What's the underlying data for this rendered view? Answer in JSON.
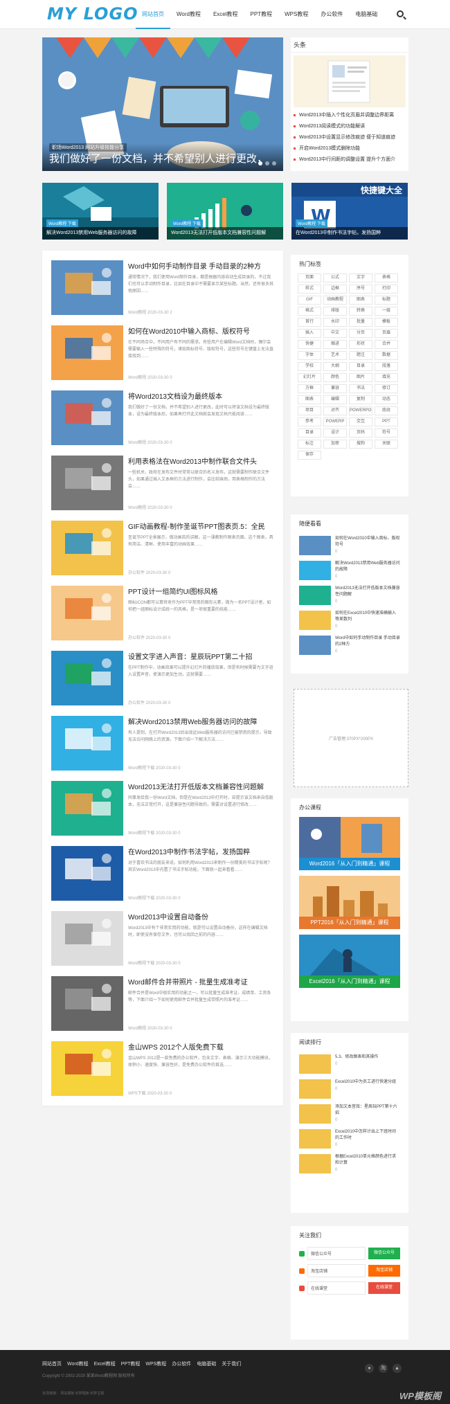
{
  "logo": "MY LOGO",
  "nav": [
    "网站首页",
    "Word教程",
    "Excel教程",
    "PPT教程",
    "WPS教程",
    "办公软件",
    "电脑基础"
  ],
  "slider": {
    "tag": "职场Word2013 网站升级技能分享",
    "title": "我们做好了一份文档，并不希望别人进行更改，"
  },
  "headlines": {
    "title": "头条",
    "items": [
      "Word2013中插入个性化页眉并调整边界距离",
      "Word2013阅读模式的功能解读",
      "Word2013中设置显示修改痕迹 便于知道痕迹",
      "开启Word2013模式删除功能",
      "Word2013中行间距的调整设置 提升个方面介"
    ]
  },
  "features": [
    {
      "tag": "Word教程 下载",
      "label": "解决Word2013禁用Web服务器访问的故障"
    },
    {
      "tag": "Word教程 下载",
      "label": "Word2013无法打开低版本文档兼容性问题解"
    },
    {
      "tag": "Word教程 下载",
      "label": "在Word2013中制作书法字帖，发扬国粹"
    }
  ],
  "articles": [
    {
      "title": "Word中如何手动制作目录 手动目录的2种方",
      "desc": "通常情况下，我们使用Word制作目录，都是根据内容自动生成目录的，不过我们也可以手动制作目录，比如在目录中不需要显示某些标题。当然，还有很多其他原因……",
      "meta": "Word教程 2020-03-30 2"
    },
    {
      "title": "如何在Word2010中输入商标、版权符号",
      "desc": "在不同场合中，不同用户有不同的需求。有些用户在编辑Word文档时，偶尔会需要输入一些特殊的符号，诸如商标符号、版权符号，这些符号在键盘上无法直接找到……",
      "meta": "Word教程 2020-03-30 0"
    },
    {
      "title": "将Word2013文档设为最终版本",
      "desc": "我们做好了一份文档，并不希望别人进行更改，此时可以将该文档设为最终版本，设为最终版本后，如果再打开此文档就会发现文档只能阅读……",
      "meta": "Word教程 2020-03-30 0"
    },
    {
      "title": "利用表格法在Word2013中制作联合文件头",
      "desc": "一些机关、政府在发布文件时常常以联合的名义发布，这就需要制作联合文件头，如果通过插入文本框的方法进行制作，会比较麻烦，用表格制作的方法会……",
      "meta": "Word教程 2020-03-30 0"
    },
    {
      "title": "GIF动画教程-制作圣诞节PPT图表页.5：全民",
      "desc": "圣诞节PPT全景展示，做动画前的讲解，这一课教制作图表页面。这个图表，具有简洁、清晰、使用丰富的动画效果……",
      "meta": "办公软件 2020-03-30 0"
    },
    {
      "title": "PPT设计一组简约UI图标风格",
      "desc": "图标ICON都可以算将来作为PPT中常用的图形元素，做为一名PPT设计者，如何把一组图标设计成统一的风格，是一项很重要的技能……",
      "meta": "办公软件 2020-03-30 0"
    },
    {
      "title": "设置文字进入声音：星辰玩PPT第二十招",
      "desc": "在PPT制作中，动画效果可以提升幻灯片的播放效果，但是有时候需要为文字进入设置声音，使演示更加生动，这就需要……",
      "meta": "办公软件 2020-03-30 0"
    },
    {
      "title": "解决Word2013禁用Web服务器访问的故障",
      "desc": "有人提到，在打开Word2013后出现此Web服务器的访问已被禁用的提示，导致无法访问网络上的资源，下面介绍一下解决方法……",
      "meta": "Word教程下载 2020-03-30 0"
    },
    {
      "title": "Word2013无法打开低版本文档兼容性问题解",
      "desc": "同事发给我一份Word文档，但是在Word2013中打开时，却提示该文档来自低版本，无法正常打开，这是兼容性问题导致的，需要对设置进行修改……",
      "meta": "Word教程下载 2020-03-30 0"
    },
    {
      "title": "在Word2013中制作书法字帖，发扬国粹",
      "desc": "对于喜欢书法的朋友来说，如何利用Word2013来制作一份精美的书法字帖呢？其实Word2013中内置了书法字帖功能，下面就一起来看看……",
      "meta": "Word教程下载 2020-03-30 0"
    },
    {
      "title": "Word2013中设置自动备份",
      "desc": "Word2013中有个非常实用的功能，就是可以设置自动备份，这样在编辑文档时，即使没有保存文件，也可以找回之前的内容……",
      "meta": "Word教程下载 2020-03-30 0"
    },
    {
      "title": "Word邮件合并带照片 - 批量生成准考证",
      "desc": "邮件合并是Word中很实用的功能之一，可以批量生成准考证、成绩单、工资条等，下面介绍一下如何使用邮件合并批量生成带照片的准考证……",
      "meta": "Word教程 2020-03-30 0"
    },
    {
      "title": "金山WPS 2012个人版免费下载",
      "desc": "金山WPS 2012是一款免费的办公软件，包含文字、表格、演示三大功能模块，体积小、速度快、兼容性好，是免费办公软件的首选……",
      "meta": "WPS下载 2020-03-30 0"
    }
  ],
  "tags": {
    "title": "热门标签",
    "items": [
      "页面",
      "公式",
      "文字",
      "表格",
      "样式",
      "边框",
      "序号",
      "打印",
      "GIF",
      "动画教程",
      "图表",
      "标题",
      "格式",
      "排版",
      "转换",
      "一级",
      "首行",
      "水印",
      "批量",
      "模板",
      "插入",
      "中文",
      "分页",
      "页眉",
      "快捷",
      "缩进",
      "形状",
      "合并",
      "字体",
      "艺术",
      "题注",
      "数据",
      "学校",
      "大纲",
      "目录",
      "段落",
      "幻灯片",
      "颜色",
      "图片",
      "填充",
      "方框",
      "兼容",
      "书法",
      "修订",
      "图表",
      "编辑",
      "复制",
      "动态",
      "项目",
      "对齐",
      "POWERPOINT",
      "底纹",
      "参考",
      "POWERP",
      "交互",
      "PPT",
      "目录",
      "设计",
      "页码",
      "符号",
      "标注",
      "加密",
      "搜狗",
      "关联",
      "保存"
    ]
  },
  "recommend": {
    "title": "随便看看",
    "items": [
      {
        "label": "如何在Word2010中输入商标、版权符号",
        "meta": "0"
      },
      {
        "label": "解决Word2013禁用Web服务器访问的故障",
        "meta": "0"
      },
      {
        "label": "Word2013无法打开低版本文档兼容性问题解",
        "meta": "0"
      },
      {
        "label": "如何在Excel2010中快速准确输入等差数列",
        "meta": "0"
      },
      {
        "label": "Word中如何手动制作目录 手动目录的2种方",
        "meta": "0"
      }
    ]
  },
  "ad": "广告管理:370PX*200PX",
  "courses": {
    "title": "办公课程",
    "items": [
      "Word2016「从入门到精通」课程",
      "PPT2016「从入门到精通」课程",
      "Excel2016「从入门到精通」课程"
    ]
  },
  "ranking": {
    "title": "阅读排行",
    "items": [
      {
        "label": "5.3、修改图表和其操作",
        "meta": "0"
      },
      {
        "label": "Excel2010中为员工进行快速分组",
        "meta": "0"
      },
      {
        "label": "添加文本音效：星辰玩PPT第十六招",
        "meta": "0"
      },
      {
        "label": "Excel2010中怎样计出上下班时间的工作时",
        "meta": "0"
      },
      {
        "label": "根据Excel2010单元格颜色进行求和计算",
        "meta": "0"
      }
    ]
  },
  "follow": {
    "title": "关注我们",
    "items": [
      {
        "name": "微信公众号",
        "btn": "微信公众号",
        "color": "#20b04d"
      },
      {
        "name": "淘宝店铺",
        "btn": "淘宝店铺",
        "color": "#ff6a00"
      },
      {
        "name": "在线课堂",
        "btn": "在线课堂",
        "color": "#e84c3d"
      }
    ]
  },
  "footer": {
    "nav": [
      "网站首页",
      "Word教程",
      "Excel教程",
      "PPT教程",
      "WPS教程",
      "办公软件",
      "电脑基础",
      "关于我们"
    ],
    "copyright": "Copyright © 2002-2020 某某Word教程网 版权所有",
    "links": "友情链接： 网站模板  织梦模板  织梦主题"
  },
  "watermark": "WP模板阁"
}
